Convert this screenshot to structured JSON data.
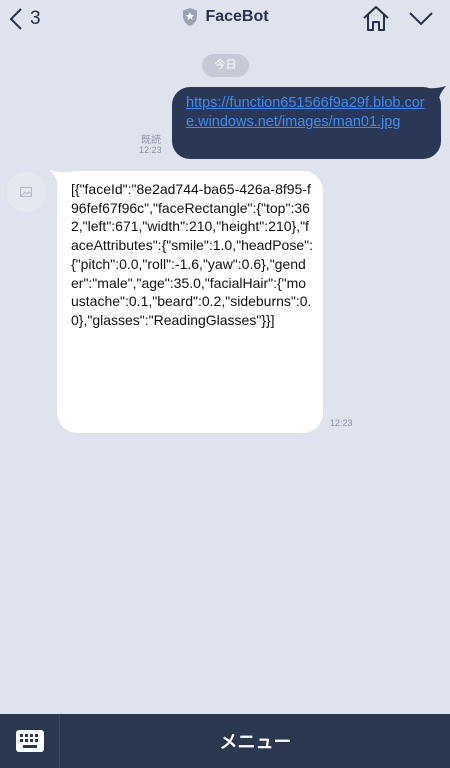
{
  "header": {
    "back_count": "3",
    "title": "FaceBot",
    "icons": {
      "back": "chevron-left-icon",
      "verified": "shield-icon",
      "home": "home-icon",
      "menu_toggle": "chevron-down-icon"
    }
  },
  "chat": {
    "date_label": "今日",
    "outgoing": {
      "link_text": "https://function651566f9a29f.blob.core.windows.net/images/man01.jpg",
      "read_label": "既読",
      "time": "12:23"
    },
    "incoming": {
      "avatar_icon": "image-placeholder-icon",
      "text": "[{\"faceId\":\"8e2ad744-ba65-426a-8f95-f96fef67f96c\",\"faceRectangle\":{\"top\":362,\"left\":671,\"width\":210,\"height\":210},\"faceAttributes\":{\"smile\":1.0,\"headPose\":{\"pitch\":0.0,\"roll\":-1.6,\"yaw\":0.6},\"gender\":\"male\",\"age\":35.0,\"facialHair\":{\"moustache\":0.1,\"beard\":0.2,\"sideburns\":0.0},\"glasses\":\"ReadingGlasses\"}}]",
      "time": "12:23"
    }
  },
  "footer": {
    "keyboard_icon": "keyboard-icon",
    "menu_label": "メニュー"
  },
  "colors": {
    "background": "#dfe3ed",
    "outgoing_bubble": "#2a3855",
    "link": "#3e8cf5",
    "footer": "#29374f"
  }
}
